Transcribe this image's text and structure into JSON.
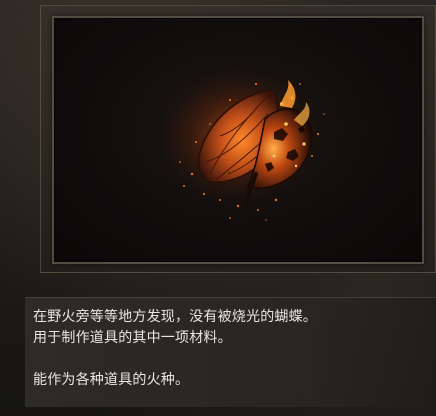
{
  "description": {
    "line1": "在野火旁等等地方发现，没有被烧光的蝴蝶。",
    "line2": "用于制作道具的其中一项材料。",
    "line3": "能作为各种道具的火种。"
  },
  "item_image": {
    "icon": "smoldering-butterfly-icon"
  }
}
